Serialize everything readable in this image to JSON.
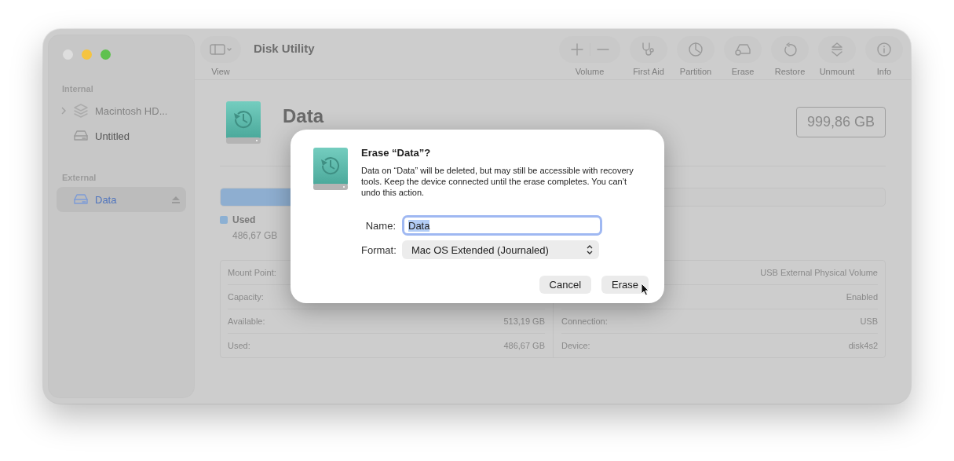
{
  "window": {
    "controls": [
      {
        "color": "#dedede"
      },
      {
        "color": "#f5c440"
      },
      {
        "color": "#5fc14f"
      }
    ]
  },
  "toolbar": {
    "view_label": "View",
    "title": "Disk Utility",
    "buttons": [
      {
        "kind": "volume",
        "label": "Volume"
      },
      {
        "kind": "first_aid",
        "label": "First Aid"
      },
      {
        "kind": "partition",
        "label": "Partition"
      },
      {
        "kind": "erase",
        "label": "Erase"
      },
      {
        "kind": "restore",
        "label": "Restore"
      },
      {
        "kind": "unmount",
        "label": "Unmount"
      },
      {
        "kind": "info",
        "label": "Info"
      }
    ]
  },
  "sidebar": {
    "sections": [
      {
        "title": "Internal",
        "items": [
          {
            "label": "Macintosh HD...",
            "kind": "stack",
            "expanded": false,
            "selected": false,
            "disabled": true,
            "eject": false
          },
          {
            "label": "Untitled",
            "kind": "drive",
            "selected": false,
            "disabled": false,
            "eject": false
          }
        ]
      },
      {
        "title": "External",
        "items": [
          {
            "label": "Data",
            "kind": "drive",
            "selected": true,
            "disabled": false,
            "eject": true
          }
        ]
      }
    ]
  },
  "volume": {
    "name": "Data",
    "capacity": "999,86 GB",
    "usage": {
      "level": 0.49
    },
    "legend": [
      {
        "label": "Used",
        "value": "486,67 GB",
        "color": "#8cb0d3"
      }
    ],
    "info_left": [
      {
        "label": "Mount Point:"
      },
      {
        "label": "Capacity:"
      },
      {
        "label": "Available:",
        "value": "513,19 GB"
      },
      {
        "label": "Used:",
        "value": "486,67 GB"
      }
    ],
    "info_right": [
      {
        "value": "USB External Physical Volume"
      },
      {
        "value": "Enabled"
      },
      {
        "label": "Connection:",
        "value": "USB"
      },
      {
        "label": "Device:",
        "value": "disk4s2"
      }
    ]
  },
  "dialog": {
    "title": "Erase “Data”?",
    "message": "Data on “Data” will be deleted, but may still be accessible with recovery tools. Keep the device connected until the erase completes. You can’t undo this action.",
    "name_label": "Name:",
    "name_value": "Data",
    "name_selected": true,
    "format_label": "Format:",
    "format_value": "Mac OS Extended (Journaled)",
    "buttons": [
      {
        "label": "Cancel",
        "default": false
      },
      {
        "label": "Erase",
        "default": false
      }
    ]
  }
}
